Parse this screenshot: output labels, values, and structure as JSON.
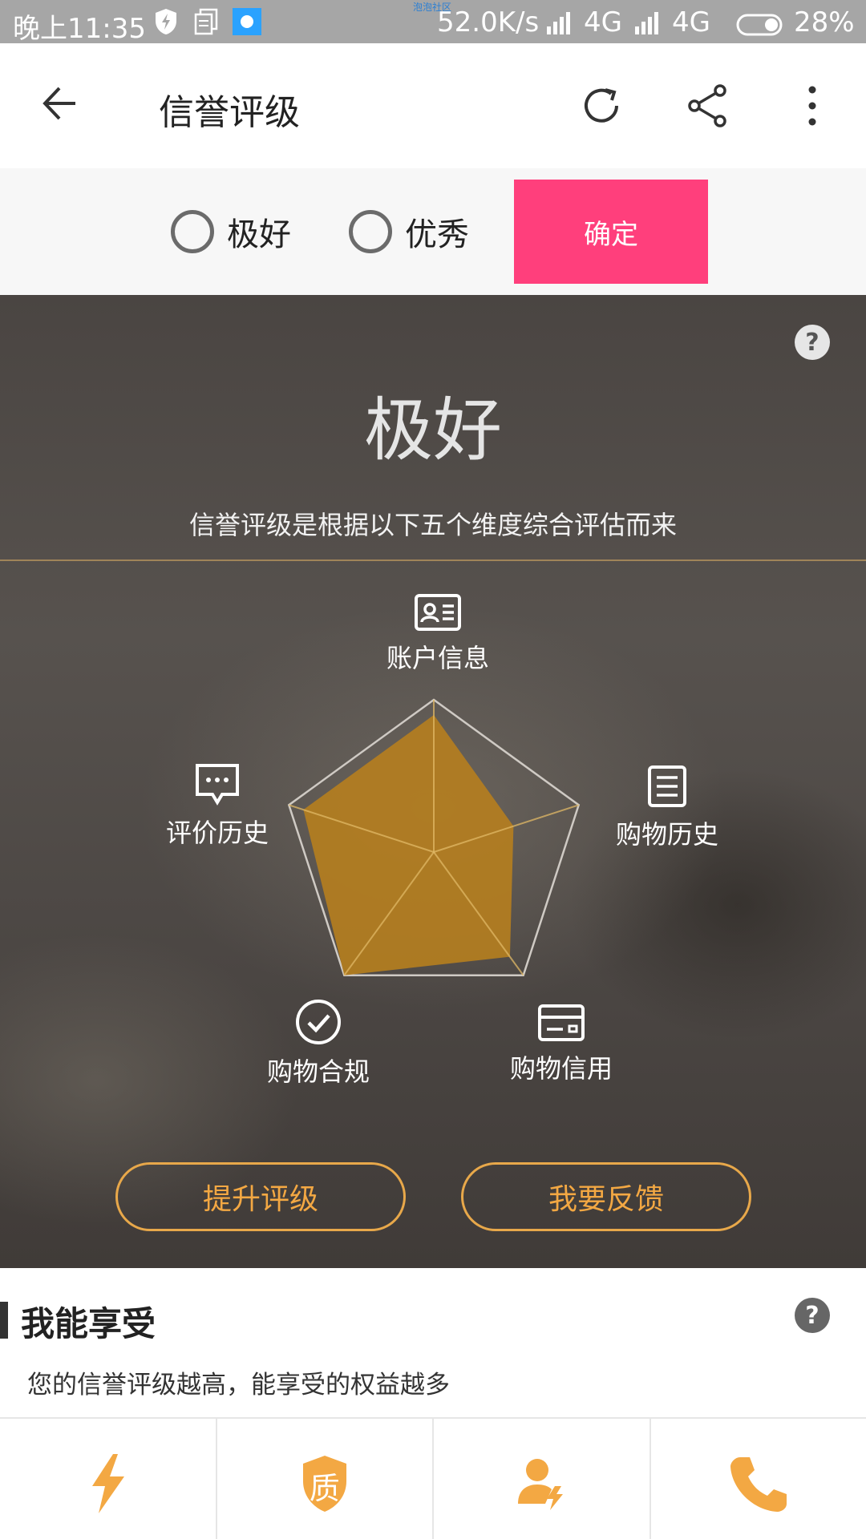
{
  "status_bar": {
    "time": "晚上11:35",
    "tiny_text": "泡泡社区",
    "speed": "52.0K/s",
    "network1": "4G",
    "network2": "4G",
    "battery": "28%"
  },
  "toolbar": {
    "title": "信誉评级"
  },
  "filter": {
    "options": [
      {
        "label": "极好",
        "selected": false
      },
      {
        "label": "优秀",
        "selected": false
      }
    ],
    "confirm_label": "确定"
  },
  "hero": {
    "grade": "极好",
    "description": "信誉评级是根据以下五个维度综合评估而来",
    "dimensions": [
      {
        "label": "账户信息",
        "icon": "id-card-icon",
        "score": 0.9
      },
      {
        "label": "购物历史",
        "icon": "document-list-icon",
        "score": 0.55
      },
      {
        "label": "购物信用",
        "icon": "credit-card-icon",
        "score": 0.85
      },
      {
        "label": "购物合规",
        "icon": "check-circle-icon",
        "score": 1.0
      },
      {
        "label": "评价历史",
        "icon": "chat-bubble-icon",
        "score": 0.9
      }
    ],
    "buttons": {
      "improve": "提升评级",
      "feedback": "我要反馈"
    }
  },
  "benefits": {
    "title": "我能享受",
    "subtitle": "您的信誉评级越高，能享受的权益越多",
    "items": [
      {
        "icon": "lightning-icon"
      },
      {
        "icon": "quality-shield-icon",
        "text": "质"
      },
      {
        "icon": "user-fast-icon"
      },
      {
        "icon": "phone-icon"
      }
    ]
  },
  "colors": {
    "accent_pink": "#ff3f7c",
    "accent_orange": "#f3a843",
    "radar_fill": "#b47e1f"
  }
}
